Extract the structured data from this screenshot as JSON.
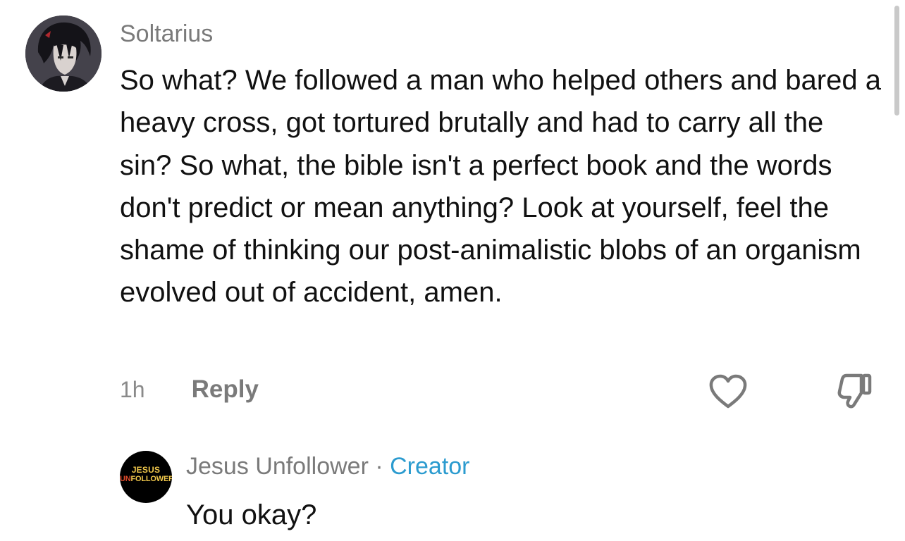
{
  "comment": {
    "username": "Soltarius",
    "text": "So what? We followed a man who helped others and bared a heavy cross, got tortured brutally and had to carry all the sin? So what, the bible isn't a perfect book and the words don't predict or mean anything? Look at yourself, feel the shame of thinking our post-animalistic blobs of an organism evolved out of accident, amen.",
    "time": "1h",
    "reply_label": "Reply",
    "like_icon": "heart-outline-icon",
    "dislike_icon": "thumbs-down-outline-icon"
  },
  "reply": {
    "avatar_logo": {
      "line1": "JESUS",
      "line2_prefix": "UN",
      "line2_rest": "FOLLOWER"
    },
    "username": "Jesus Unfollower",
    "separator": "·",
    "badge": "Creator",
    "text": "You okay?"
  },
  "colors": {
    "creator_badge": "#2b9bcf",
    "meta_text": "#7a7a7a",
    "logo_yellow": "#f2c94c",
    "logo_red": "#e04b2b"
  }
}
